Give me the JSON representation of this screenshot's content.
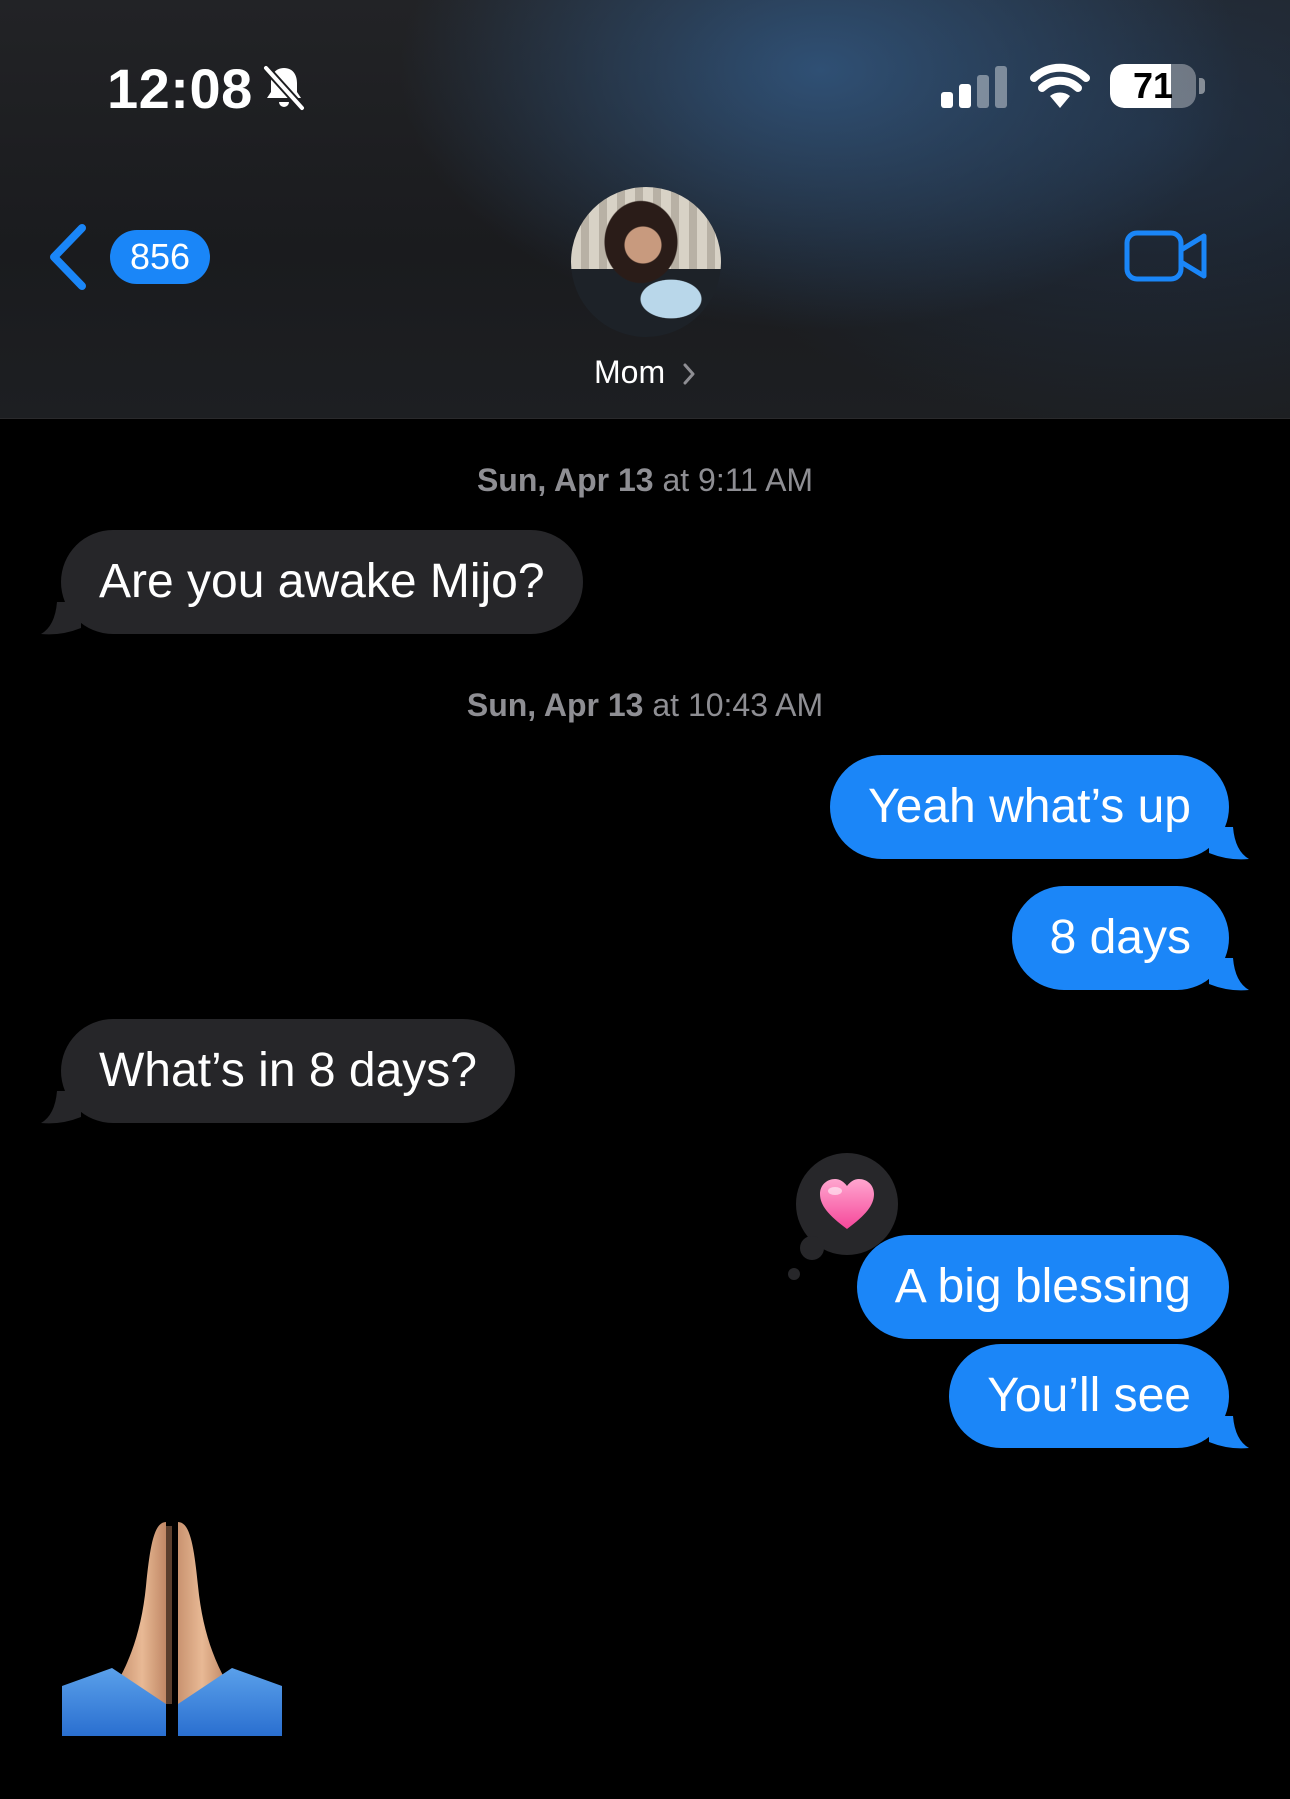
{
  "status_bar": {
    "time": "12:08",
    "silent_icon": "bell-slash-icon",
    "battery_level": "71",
    "battery_fraction": 0.71
  },
  "nav": {
    "back_icon": "chevron-left-icon",
    "unread_count": "856",
    "contact_name": "Mom",
    "contact_chevron": "chevron-right-icon",
    "video_icon": "video-camera-icon"
  },
  "colors": {
    "accent": "#1a86f8",
    "incoming_bubble": "#262629",
    "outgoing_bubble": "#1b86f8",
    "timestamp": "#8e8e93"
  },
  "conversation": {
    "stamp1": {
      "day": "Sun, Apr 13",
      "at": " at ",
      "time": "9:11 AM"
    },
    "msg1": "Are you awake Mijo?",
    "stamp2": {
      "day": "Sun, Apr 13",
      "at": " at ",
      "time": "10:43 AM"
    },
    "msg2": "Yeah what’s up",
    "msg3": "8 days",
    "msg4": "What’s in 8 days?",
    "msg5": "A big blessing",
    "msg5_tapback": "heart-icon",
    "msg6": "You’ll see",
    "msg7_emoji": "folded-hands-emoji"
  }
}
